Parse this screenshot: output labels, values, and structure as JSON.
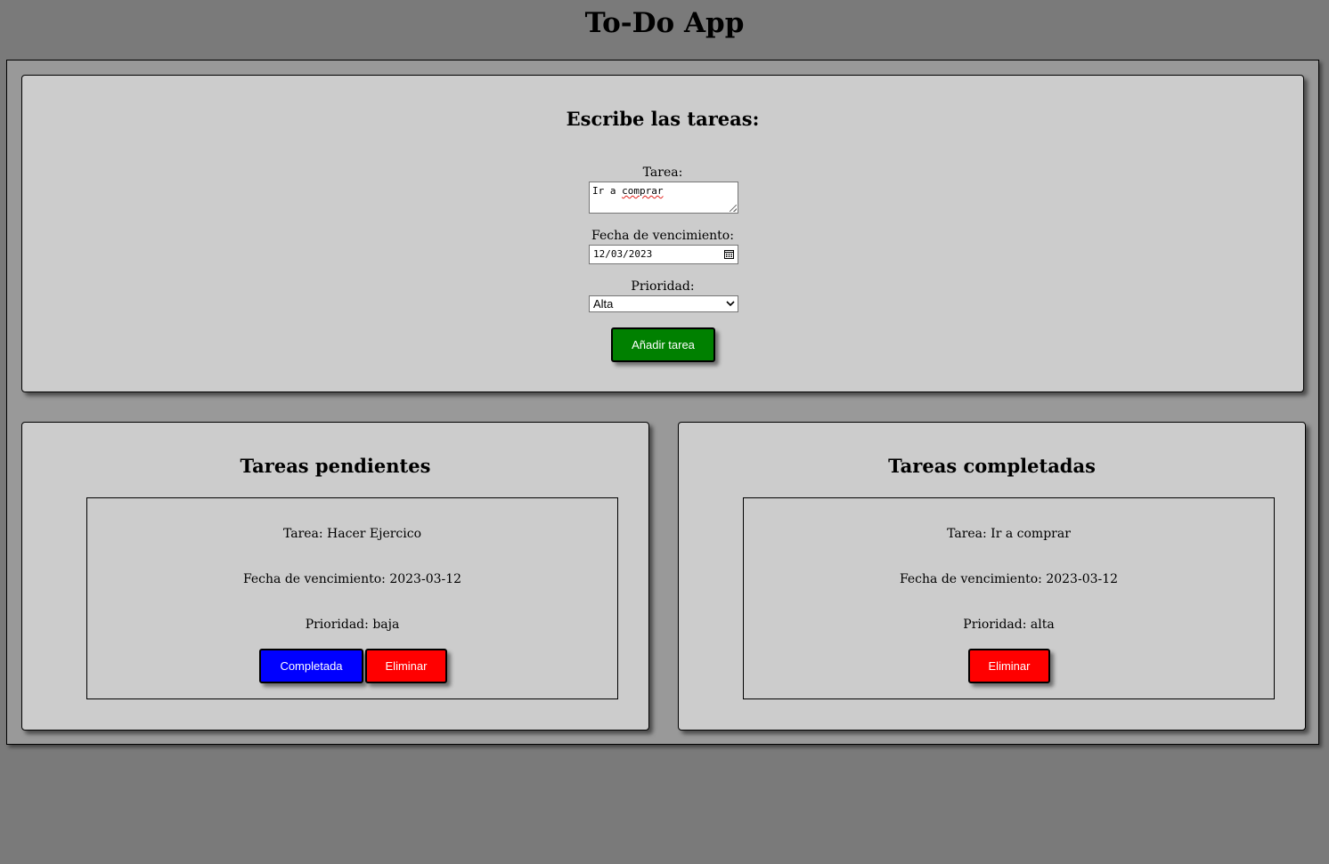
{
  "app": {
    "title": "To-Do App"
  },
  "form": {
    "heading": "Escribe las tareas:",
    "task_label": "Tarea:",
    "task_value": "Ir a comprar",
    "due_label": "Fecha de vencimiento:",
    "due_value": "12/03/2023",
    "priority_label": "Prioridad:",
    "priority_value": "Alta",
    "add_button": "Añadir tarea"
  },
  "pending": {
    "heading": "Tareas pendientes",
    "tasks": [
      {
        "task": "Tarea: Hacer Ejercico",
        "due": "Fecha de vencimiento: 2023-03-12",
        "priority": "Prioridad: baja",
        "complete_button": "Completada",
        "delete_button": "Eliminar"
      }
    ]
  },
  "completed": {
    "heading": "Tareas completadas",
    "tasks": [
      {
        "task": "Tarea: Ir a comprar",
        "due": "Fecha de vencimiento: 2023-03-12",
        "priority": "Prioridad: alta",
        "delete_button": "Eliminar"
      }
    ]
  },
  "colors": {
    "page_bg": "#7a7a7a",
    "container_bg": "#999999",
    "panel_bg": "#cccccc",
    "add_button": "#008000",
    "complete_button": "#0000ff",
    "delete_button": "#ff0000"
  },
  "icons": {
    "date_picker": "calendar-icon",
    "select_arrow": "chevron-down-icon"
  }
}
